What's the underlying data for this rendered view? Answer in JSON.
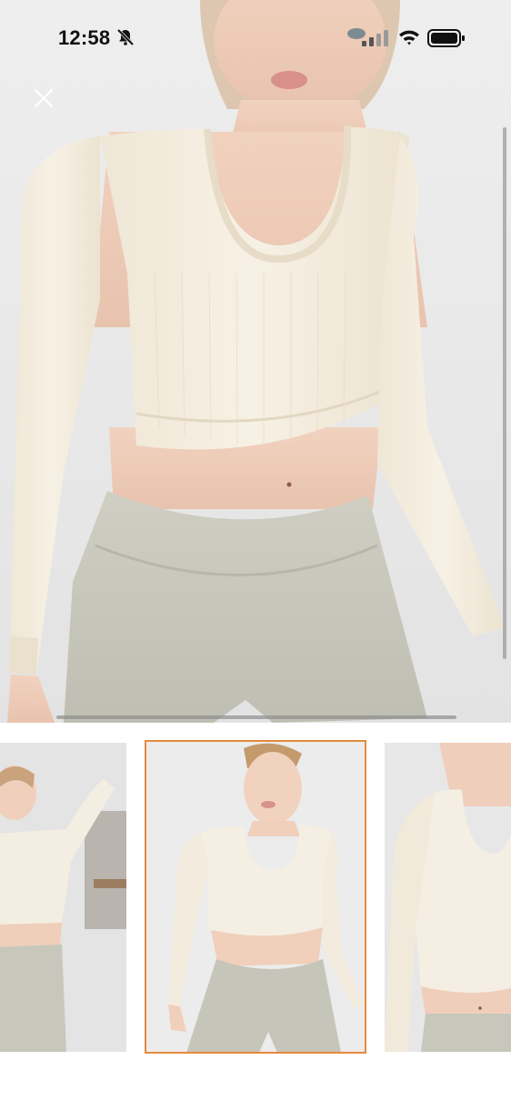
{
  "status_bar": {
    "time": "12:58",
    "icons": [
      "bell-slash-icon",
      "cellular-signal-icon",
      "wifi-icon",
      "battery-icon"
    ]
  },
  "viewer": {
    "close_icon": "close-icon",
    "image_description": "product-photo-main",
    "thumbnails_count": 3,
    "selected_thumbnail_index": 1,
    "colors": {
      "selected_outline": "#e48a3c",
      "top_color": "#f5efe2",
      "leggings_color": "#c9c8bd",
      "background": "#eeeeee"
    }
  }
}
